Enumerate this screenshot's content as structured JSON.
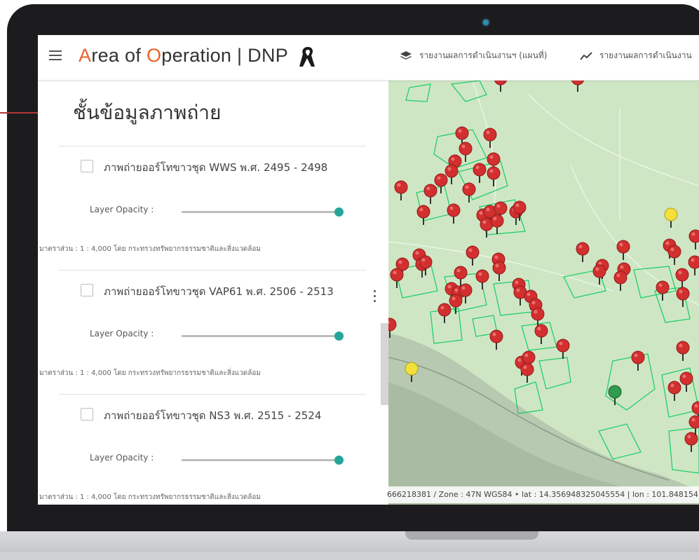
{
  "app": {
    "title_a": "A",
    "title_rea": "rea of ",
    "title_o": "O",
    "title_rest": "peration | DNP",
    "accent_color": "#e8622a"
  },
  "nav": [
    {
      "label": "รายงานผลการดำเนินงานฯ (แผนที่)",
      "icon": "layers-icon"
    },
    {
      "label": "รายงานผลการดำเนินงาน",
      "icon": "trend-line-icon"
    }
  ],
  "panel": {
    "title": "ชั้นข้อมูลภาพถ่าย",
    "layers": [
      {
        "name": "ภาพถ่ายออร์โทขาวชุด WWS พ.ศ. 2495 - 2498",
        "opacity_label": "Layer Opacity :",
        "opacity": 1.0,
        "scale": "มาตราส่วน : 1 : 4,000 โดย กระทรวงทรัพยากรธรรมชาติและสิ่งแวดล้อม",
        "checked": false
      },
      {
        "name": "ภาพถ่ายออร์โทขาวชุด VAP61 พ.ศ. 2506 - 2513",
        "opacity_label": "Layer Opacity :",
        "opacity": 1.0,
        "scale": "มาตราส่วน : 1 : 4,000 โดย กระทรวงทรัพยากรธรรมชาติและสิ่งแวดล้อม",
        "checked": false
      },
      {
        "name": "ภาพถ่ายออร์โทขาวชุด NS3 พ.ศ. 2515 - 2524",
        "opacity_label": "Layer Opacity :",
        "opacity": 1.0,
        "scale": "มาตราส่วน : 1 : 4,000 โดย กระทรวงทรัพยากรธรรมชาติและสิ่งแวดล้อม",
        "checked": false
      }
    ]
  },
  "map": {
    "coord_text": "666218381 / Zone : 47N WGS84 • lat : 14.356948325045554 | lon : 101.848154",
    "marker_colors": {
      "red": "#d32f2f",
      "yellow": "#f4e03a",
      "green": "#2e9d4f"
    },
    "polygon_color": "#1fcf6a"
  },
  "colors": {
    "slider_thumb": "#26a69a",
    "callout": "#b1353a"
  }
}
